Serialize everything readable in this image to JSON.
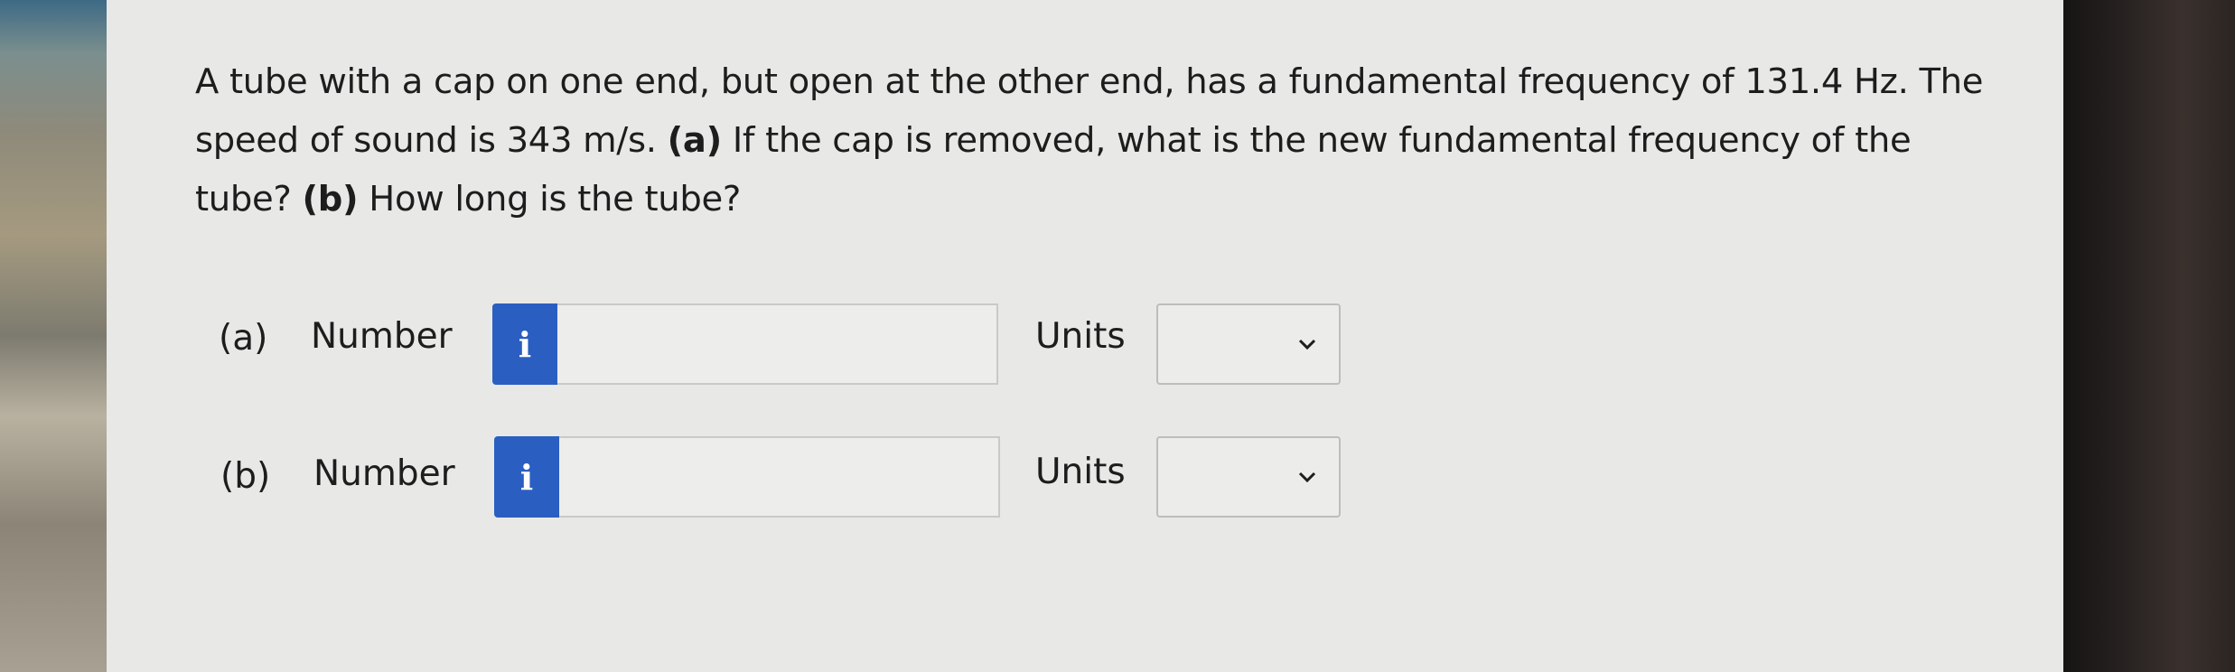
{
  "question": {
    "text_1": "A tube with a cap on one end, but open at the other end, has a fundamental frequency of 131.4 Hz. The",
    "text_2": "speed of sound is 343 m/s. ",
    "bold_a": "(a)",
    "text_3": " If the cap is removed, what is the new fundamental frequency of the",
    "text_4": "tube? ",
    "bold_b": "(b)",
    "text_5": " How long is the tube?"
  },
  "parts": [
    {
      "label": "(a)",
      "number_label": "Number",
      "info_icon": "i",
      "number_value": "",
      "units_label": "Units",
      "units_value": ""
    },
    {
      "label": "(b)",
      "number_label": "Number",
      "info_icon": "i",
      "number_value": "",
      "units_label": "Units",
      "units_value": ""
    }
  ],
  "colors": {
    "info_button": "#2a5fc1",
    "panel_bg": "#e8e8e6",
    "text": "#1d1d1d"
  }
}
